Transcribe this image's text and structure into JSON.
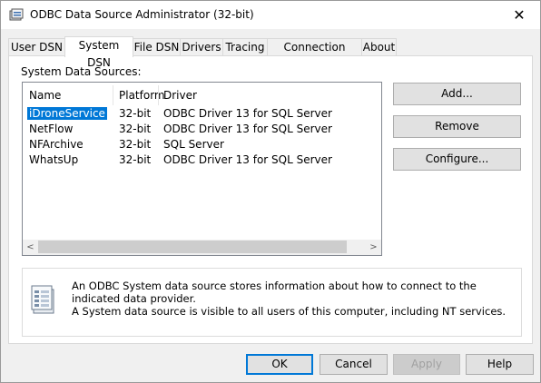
{
  "window": {
    "title": "ODBC Data Source Administrator (32-bit)",
    "close_glyph": "✕",
    "icon": "odbc-app-icon"
  },
  "tabs": [
    {
      "label": "User DSN"
    },
    {
      "label": "System DSN"
    },
    {
      "label": "File DSN"
    },
    {
      "label": "Drivers"
    },
    {
      "label": "Tracing"
    },
    {
      "label": "Connection Pooling"
    },
    {
      "label": "About"
    }
  ],
  "active_tab": "System DSN",
  "system_sources": {
    "label": "System Data Sources:",
    "columns": [
      "Name",
      "Platform",
      "Driver"
    ],
    "rows": [
      {
        "name": "iDroneService",
        "platform": "32-bit",
        "driver": "ODBC Driver 13 for SQL Server"
      },
      {
        "name": "NetFlow",
        "platform": "32-bit",
        "driver": "ODBC Driver 13 for SQL Server"
      },
      {
        "name": "NFArchive",
        "platform": "32-bit",
        "driver": "SQL Server"
      },
      {
        "name": "WhatsUp",
        "platform": "32-bit",
        "driver": "ODBC Driver 13 for SQL Server"
      }
    ],
    "selected_row": "iDroneService"
  },
  "side_buttons": {
    "add": "Add...",
    "remove": "Remove",
    "configure": "Configure..."
  },
  "info": {
    "line1": "An ODBC System data source stores information about how to connect to the indicated data provider.",
    "line2": "A System data source is visible to all users of this computer, including NT services.",
    "icon": "data-source-icon"
  },
  "footer": {
    "ok": "OK",
    "cancel": "Cancel",
    "apply": "Apply",
    "help": "Help"
  },
  "colors": {
    "selection": "#0078d7",
    "default_button_border": "#0078d7"
  }
}
